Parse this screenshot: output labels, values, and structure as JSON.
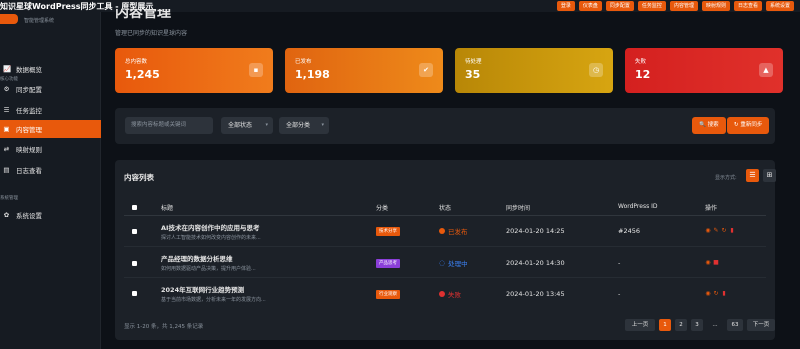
{
  "app": {
    "title": "知识星球WordPress同步工具 - 原型展示"
  },
  "topnav": [
    "登录",
    "仪表盘",
    "同步配置",
    "任务监控",
    "内容管理",
    "映射规则",
    "日志查看",
    "系统设置"
  ],
  "sidebar": {
    "brand_sub": "智能管理系统",
    "section_core": "核心功能",
    "items": [
      {
        "label": "数据概览",
        "icon": "chart-line-icon",
        "glyph": "📈"
      },
      {
        "label": "同步配置",
        "icon": "gear-icon",
        "glyph": "⚙"
      },
      {
        "label": "任务监控",
        "icon": "list-icon",
        "glyph": "☰"
      },
      {
        "label": "内容管理",
        "icon": "folder-icon",
        "glyph": "▣"
      },
      {
        "label": "映射规则",
        "icon": "swap-icon",
        "glyph": "⇄"
      },
      {
        "label": "日志查看",
        "icon": "file-icon",
        "glyph": "▤"
      }
    ],
    "section_system": "系统管理",
    "system_items": [
      {
        "label": "系统设置",
        "icon": "cog-icon",
        "glyph": "✿"
      }
    ]
  },
  "page": {
    "title": "内容管理",
    "subtitle": "管理已同步的知识星球内容"
  },
  "stats": [
    {
      "label": "总内容数",
      "value": "1,245",
      "icon": "document-icon",
      "glyph": "▪",
      "color": "#e8590c"
    },
    {
      "label": "已发布",
      "value": "1,198",
      "icon": "check-circle-icon",
      "glyph": "✔",
      "color": "#e06410"
    },
    {
      "label": "待处理",
      "value": "35",
      "icon": "clock-icon",
      "glyph": "◷",
      "color": "#c98a06"
    },
    {
      "label": "失败",
      "value": "12",
      "icon": "warning-icon",
      "glyph": "▲",
      "color": "#d4201f"
    }
  ],
  "filters": {
    "search_placeholder": "搜索内容标题或关键词",
    "status_select": "全部状态",
    "category_select": "全部分类",
    "search_button": "搜索",
    "resync_button": "重新同步",
    "search_glyph": "🔍",
    "resync_glyph": "↻"
  },
  "list": {
    "title": "内容列表",
    "view_label": "显示方式:",
    "columns": [
      "标题",
      "分类",
      "状态",
      "同步时间",
      "WordPress ID",
      "操作"
    ],
    "rows": [
      {
        "title": "AI技术在内容创作中的应用与思考",
        "desc": "探讨人工智能技术如何改变内容创作的未来...",
        "category": "技术分享",
        "category_color": "#e8590c",
        "status": "已发布",
        "status_color": "#e8590c",
        "time": "2024-01-20 14:25",
        "wp_id": "#2456"
      },
      {
        "title": "产品经理的数据分析思维",
        "desc": "如何用数据驱动产品决策，提升用户体验...",
        "category": "产品思考",
        "category_color": "#8b3fd9",
        "status": "处理中",
        "status_color": "#3b82f6",
        "time": "2024-01-20 14:30",
        "wp_id": "-"
      },
      {
        "title": "2024年互联网行业趋势预测",
        "desc": "基于当前市场数据，分析未来一年的发展方向...",
        "category": "行业观察",
        "category_color": "#e8590c",
        "status": "失败",
        "status_color": "#e03131",
        "time": "2024-01-20 13:45",
        "wp_id": "-"
      }
    ],
    "pagination": {
      "info": "显示 1-20 条，共 1,245 条记录",
      "prev": "上一页",
      "pages": [
        "1",
        "2",
        "3"
      ],
      "dots": "...",
      "last": "63",
      "next": "下一页"
    }
  }
}
